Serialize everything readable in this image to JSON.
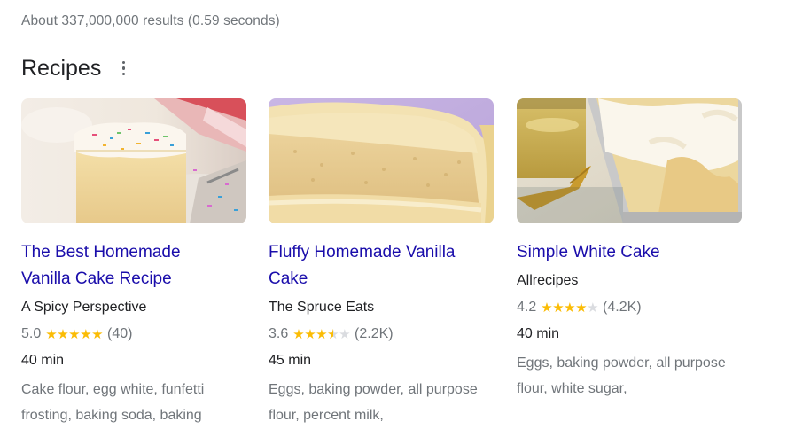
{
  "result_stats": "About 337,000,000 results (0.59 seconds)",
  "section": {
    "title": "Recipes"
  },
  "colors": {
    "link": "#1a0dab",
    "star_filled": "#fbbc04",
    "star_empty": "#dadce0",
    "secondary_text": "#70757a"
  },
  "recipes": [
    {
      "title": "The Best Homemade Vanilla Cake Recipe",
      "source": "A Spicy Perspective",
      "rating": "5.0",
      "rating_value": 5.0,
      "review_count": "(40)",
      "time": "40 min",
      "ingredients": "Cake flour, egg white, funfetti frosting, baking soda, baking",
      "image": "vanilla-funfetti-cake-photo"
    },
    {
      "title": "Fluffy Homemade Vanilla Cake",
      "source": "The Spruce Eats",
      "rating": "3.6",
      "rating_value": 3.6,
      "review_count": "(2.2K)",
      "time": "45 min",
      "ingredients": "Eggs, baking powder, all purpose flour, percent milk,",
      "image": "frosted-vanilla-layer-cake-photo"
    },
    {
      "title": "Simple White Cake",
      "source": "Allrecipes",
      "rating": "4.2",
      "rating_value": 4.2,
      "review_count": "(4.2K)",
      "time": "40 min",
      "ingredients": "Eggs, baking powder, all purpose flour, white sugar,",
      "image": "white-sheet-cake-photo"
    }
  ]
}
